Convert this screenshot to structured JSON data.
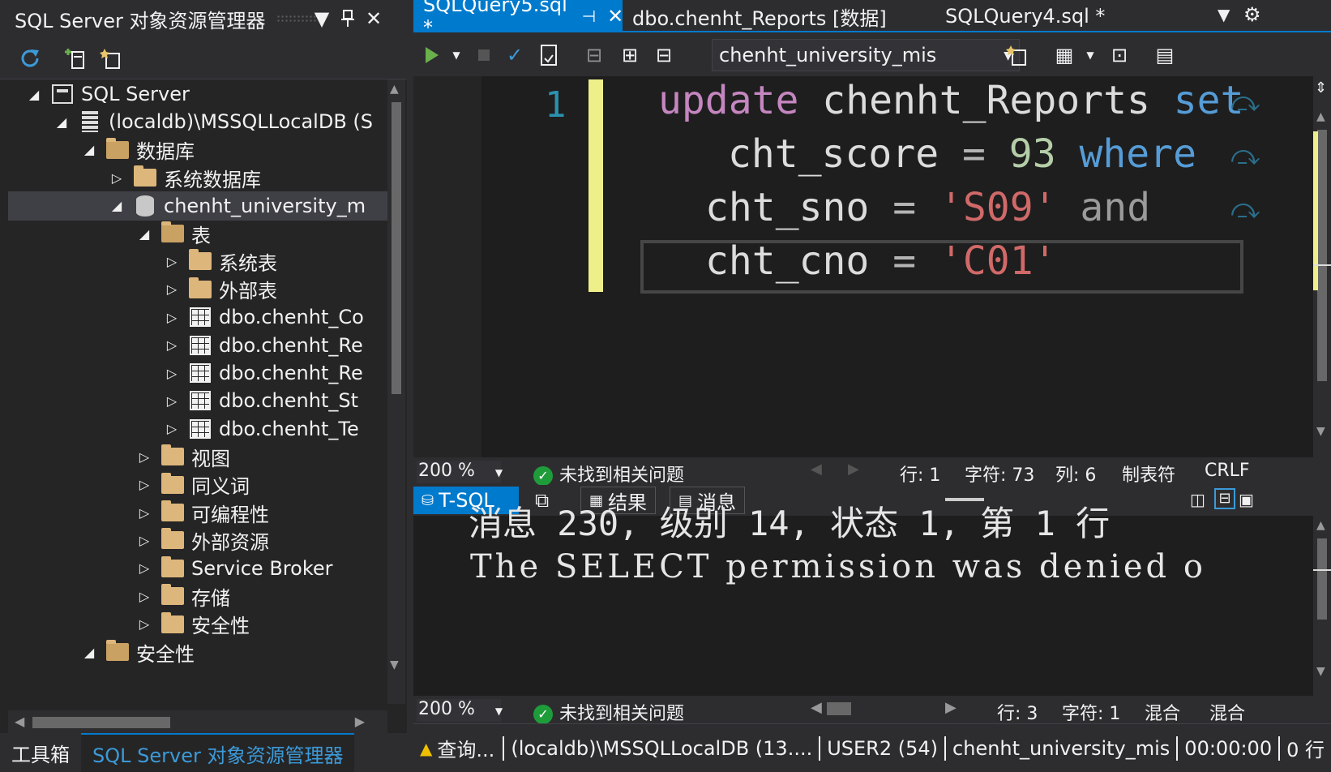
{
  "explorer": {
    "title": "SQL Server 对象资源管理器",
    "title_buttons": [
      "▼",
      "📌",
      "✕"
    ],
    "tree": [
      {
        "label": "SQL Server",
        "icon": "server-group-icon",
        "arrow": "◢",
        "level": 0
      },
      {
        "label": "(localdb)\\MSSQLLocalDB (S",
        "icon": "server-icon",
        "arrow": "◢",
        "level": 1
      },
      {
        "label": "数据库",
        "icon": "folder-open-icon",
        "arrow": "◢",
        "level": 2
      },
      {
        "label": "系统数据库",
        "icon": "folder-icon",
        "arrow": "▷",
        "level": 3
      },
      {
        "label": "chenht_university_m",
        "icon": "database-icon",
        "arrow": "◢",
        "level": 3,
        "selected": true
      },
      {
        "label": "表",
        "icon": "folder-open-icon",
        "arrow": "◢",
        "level": 4
      },
      {
        "label": "系统表",
        "icon": "folder-icon",
        "arrow": "▷",
        "level": 5
      },
      {
        "label": "外部表",
        "icon": "folder-icon",
        "arrow": "▷",
        "level": 5
      },
      {
        "label": "dbo.chenht_Co",
        "icon": "table-icon",
        "arrow": "▷",
        "level": 5
      },
      {
        "label": "dbo.chenht_Re",
        "icon": "table-icon",
        "arrow": "▷",
        "level": 5
      },
      {
        "label": "dbo.chenht_Re",
        "icon": "table-icon",
        "arrow": "▷",
        "level": 5
      },
      {
        "label": "dbo.chenht_St",
        "icon": "table-icon",
        "arrow": "▷",
        "level": 5
      },
      {
        "label": "dbo.chenht_Te",
        "icon": "table-icon",
        "arrow": "▷",
        "level": 5
      },
      {
        "label": "视图",
        "icon": "folder-icon",
        "arrow": "▷",
        "level": 4
      },
      {
        "label": "同义词",
        "icon": "folder-icon",
        "arrow": "▷",
        "level": 4
      },
      {
        "label": "可编程性",
        "icon": "folder-icon",
        "arrow": "▷",
        "level": 4
      },
      {
        "label": "外部资源",
        "icon": "folder-icon",
        "arrow": "▷",
        "level": 4
      },
      {
        "label": "Service Broker",
        "icon": "folder-icon",
        "arrow": "▷",
        "level": 4
      },
      {
        "label": "存储",
        "icon": "folder-icon",
        "arrow": "▷",
        "level": 4
      },
      {
        "label": "安全性",
        "icon": "folder-icon",
        "arrow": "▷",
        "level": 4
      },
      {
        "label": "安全性",
        "icon": "folder-open-icon",
        "arrow": "◢",
        "level": 2
      }
    ],
    "bottom_tabs": [
      "工具箱",
      "SQL Server 对象资源管理器"
    ]
  },
  "doc_tabs": [
    {
      "label": "SQLQuery5.sql *",
      "active": true,
      "pin": "⊣",
      "close": "✕"
    },
    {
      "label": "dbo.chenht_Reports [数据]"
    },
    {
      "label": "SQLQuery4.sql *"
    }
  ],
  "toolbar": {
    "database": "chenht_university_mis"
  },
  "editor": {
    "line_number": "1",
    "lines": [
      [
        {
          "t": "update",
          "c": "kw"
        },
        {
          "t": " chenht_Reports ",
          "c": "plain"
        },
        {
          "t": "set",
          "c": "kw2"
        }
      ],
      [
        {
          "t": "cht_score ",
          "c": "plain"
        },
        {
          "t": "=",
          "c": "op"
        },
        {
          "t": " 93 ",
          "c": "num"
        },
        {
          "t": "where",
          "c": "kw2"
        }
      ],
      [
        {
          "t": "cht_sno ",
          "c": "plain"
        },
        {
          "t": "=",
          "c": "op"
        },
        {
          "t": " 'S09' ",
          "c": "str"
        },
        {
          "t": "and",
          "c": "gr"
        }
      ],
      [
        {
          "t": "cht_cno ",
          "c": "plain"
        },
        {
          "t": "=",
          "c": "op"
        },
        {
          "t": " 'C01'",
          "c": "str"
        }
      ]
    ]
  },
  "editor_status": {
    "zoom": "200 %",
    "issues": "未找到相关问题",
    "row": "行: 1",
    "char": "字符: 73",
    "col": "列: 6",
    "tabs": "制表符",
    "eol": "CRLF"
  },
  "result_tabs": [
    {
      "label": "T-SQL",
      "active": true
    },
    {
      "label": "结果"
    },
    {
      "label": "消息"
    }
  ],
  "messages": {
    "line1": "消息 230, 级别 14, 状态 1, 第 1 行",
    "line2": "The SELECT permission was denied o"
  },
  "results_status": {
    "zoom": "200 %",
    "issues": "未找到相关问题",
    "row": "行: 3",
    "char": "字符: 1",
    "mix1": "混合",
    "mix2": "混合"
  },
  "query_status": {
    "state": "查询...",
    "server": "(localdb)\\MSSQLLocalDB (13....",
    "user": "USER2 (54)",
    "db": "chenht_university_mis",
    "time": "00:00:00",
    "rows": "0 行"
  },
  "colors": {
    "accent": "#007acc",
    "keyword": "#c586c0",
    "keyword_blue": "#569cd6",
    "string": "#d16969",
    "number": "#b5cea8"
  }
}
